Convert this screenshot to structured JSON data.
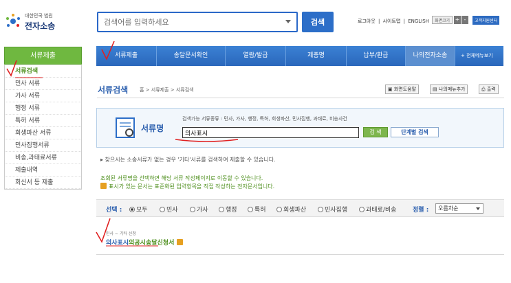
{
  "header": {
    "court_name": "대한민국 법원",
    "service_name": "전자소송",
    "search_placeholder": "검색어를 입력하세요",
    "search_button": "검색",
    "links": [
      "로그아웃",
      "|",
      "사이트맵",
      "|",
      "ENGLISH"
    ],
    "font_size_label": "화면크기",
    "font_plus": "+",
    "font_minus": "-",
    "support": "고객지원센터"
  },
  "sidebar": {
    "title": "서류제출",
    "items": [
      {
        "label": "서류검색"
      },
      {
        "label": "민사 서류"
      },
      {
        "label": "가사 서류"
      },
      {
        "label": "행정 서류"
      },
      {
        "label": "특허 서류"
      },
      {
        "label": "회생파산 서류"
      },
      {
        "label": "민사집행서류"
      },
      {
        "label": "비송,과태료서류"
      },
      {
        "label": "제출내역"
      },
      {
        "label": "회신서 등 제출"
      }
    ]
  },
  "nav": {
    "items": [
      "서류제출",
      "송달문서확인",
      "열람/발급",
      "제증명",
      "납부/환급",
      "나의전자소송"
    ],
    "all_menu": "+ 전체메뉴보기"
  },
  "page": {
    "title": "서류검색",
    "breadcrumb": "홈 > 서류제출 > 서류검색",
    "utils": [
      "화면도움말",
      "나의메뉴추가",
      "출력"
    ]
  },
  "panel": {
    "label": "서류명",
    "hint": "검색가능 서류종류 : 민사, 가사, 행정, 특허, 회생파산, 민사집행, 과태료, 비송사건",
    "input_value": "의사표시",
    "search_button": "검 색",
    "step_button": "단계별 검색"
  },
  "notes": {
    "n1": "▸ 찾으시는 소송서류가 없는 경우 '기타'서류를 검색하여 제출할 수 있습니다.",
    "n2": "조회된 서류명을 선택하면 해당 서류 작성페이지로 이동할 수 있습니다.",
    "n3": "표시가 있는 문서는 표준화된 입력항목을 직접 작성하는 전자문서입니다."
  },
  "filter": {
    "label": "선택 :",
    "options": [
      "모두",
      "민사",
      "가사",
      "행정",
      "특허",
      "회생파산",
      "민사집행",
      "과태료/비송"
    ],
    "selected": "모두",
    "sort_label": "정렬 :",
    "sort_value": "오름차순"
  },
  "result": {
    "category": "민사 ~ 기타 신청",
    "title_highlight": "의사표시",
    "title_rest": "의공시송달신청서"
  },
  "colors": {
    "nav_blue": "#2a67bb",
    "sidebar_green": "#6fb840",
    "annotation_red": "#e02020"
  }
}
